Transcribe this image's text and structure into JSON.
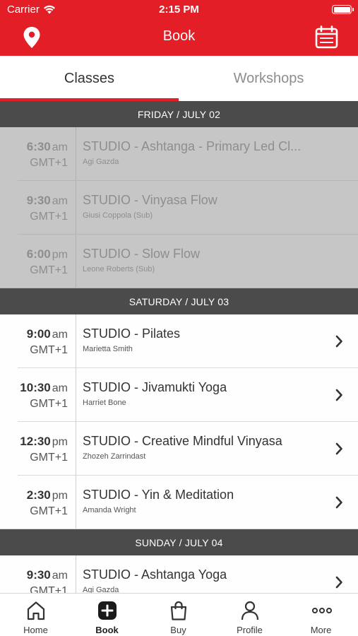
{
  "status_bar": {
    "carrier": "Carrier",
    "time": "2:15 PM"
  },
  "nav": {
    "title": "Book",
    "left_icon": "location-pin-icon",
    "right_icon": "calendar-icon"
  },
  "tabs": [
    {
      "label": "Classes",
      "active": true
    },
    {
      "label": "Workshops",
      "active": false
    }
  ],
  "days": [
    {
      "header": "FRIDAY / JULY 02",
      "past": true,
      "classes": [
        {
          "time": "6:30",
          "ampm": "am",
          "tz": "GMT+1",
          "name": "STUDIO - Ashtanga - Primary Led Cl...",
          "teacher": "Agi Gazda"
        },
        {
          "time": "9:30",
          "ampm": "am",
          "tz": "GMT+1",
          "name": "STUDIO - Vinyasa Flow",
          "teacher": "Giusi Coppola (Sub)"
        },
        {
          "time": "6:00",
          "ampm": "pm",
          "tz": "GMT+1",
          "name": "STUDIO - Slow Flow",
          "teacher": "Leone Roberts (Sub)"
        }
      ]
    },
    {
      "header": "SATURDAY / JULY 03",
      "past": false,
      "classes": [
        {
          "time": "9:00",
          "ampm": "am",
          "tz": "GMT+1",
          "name": "STUDIO - Pilates",
          "teacher": "Marietta Smith"
        },
        {
          "time": "10:30",
          "ampm": "am",
          "tz": "GMT+1",
          "name": "STUDIO - Jivamukti Yoga",
          "teacher": "Harriet Bone"
        },
        {
          "time": "12:30",
          "ampm": "pm",
          "tz": "GMT+1",
          "name": "STUDIO -  Creative Mindful Vinyasa",
          "teacher": "Zhozeh Zarrindast"
        },
        {
          "time": "2:30",
          "ampm": "pm",
          "tz": "GMT+1",
          "name": "STUDIO - Yin & Meditation",
          "teacher": "Amanda Wright"
        }
      ]
    },
    {
      "header": "SUNDAY / JULY 04",
      "past": false,
      "classes": [
        {
          "time": "9:30",
          "ampm": "am",
          "tz": "GMT+1",
          "name": "STUDIO - Ashtanga Yoga",
          "teacher": "Agi Gazda"
        }
      ]
    }
  ],
  "tabbar": [
    {
      "label": "Home",
      "icon": "home-icon",
      "active": false
    },
    {
      "label": "Book",
      "icon": "book-plus-icon",
      "active": true
    },
    {
      "label": "Buy",
      "icon": "shopping-bag-icon",
      "active": false
    },
    {
      "label": "Profile",
      "icon": "profile-icon",
      "active": false
    },
    {
      "label": "More",
      "icon": "more-dots-icon",
      "active": false
    }
  ],
  "colors": {
    "brand": "#e41e26",
    "day_header": "#4b4b4b"
  }
}
